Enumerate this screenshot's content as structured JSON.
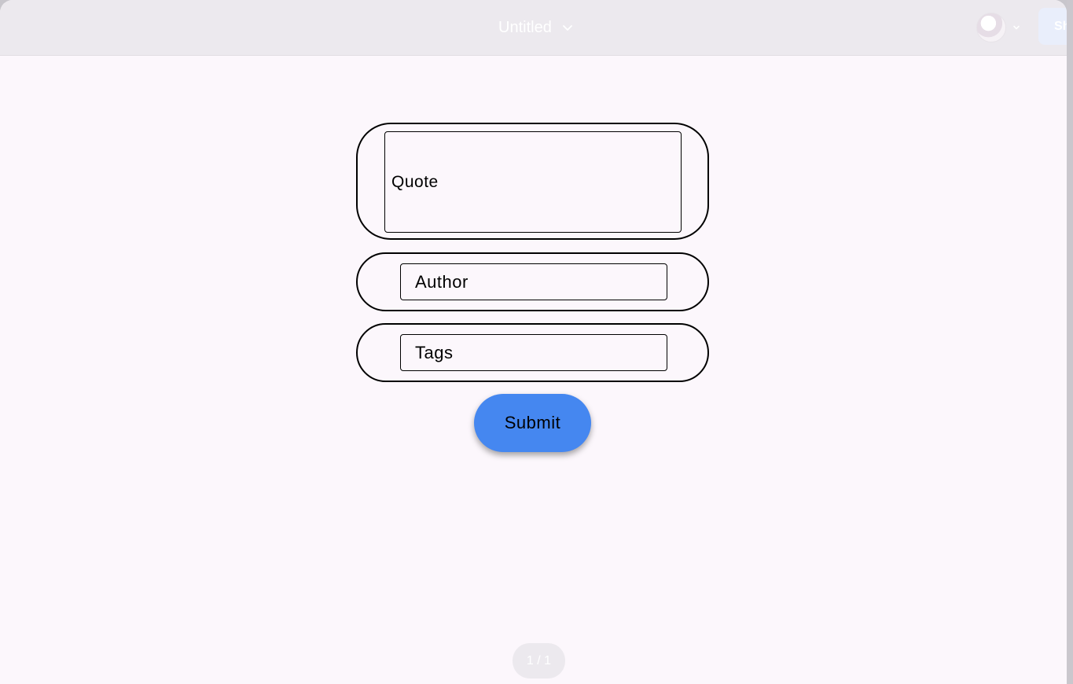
{
  "titlebar": {
    "doc_title": "Untitled",
    "title_dropdown_icon": "chevron-down-icon",
    "avatar_dropdown_icon": "chevron-down-icon",
    "share_label": "Sh"
  },
  "form": {
    "quote_label": "Quote",
    "author_label": "Author",
    "tags_label": "Tags",
    "submit_label": "Submit"
  },
  "footer": {
    "page_indicator": "1 / 1"
  },
  "colors": {
    "accent": "#4587f0",
    "background": "#fcf7fc",
    "titlebar": "#ece9ee"
  }
}
